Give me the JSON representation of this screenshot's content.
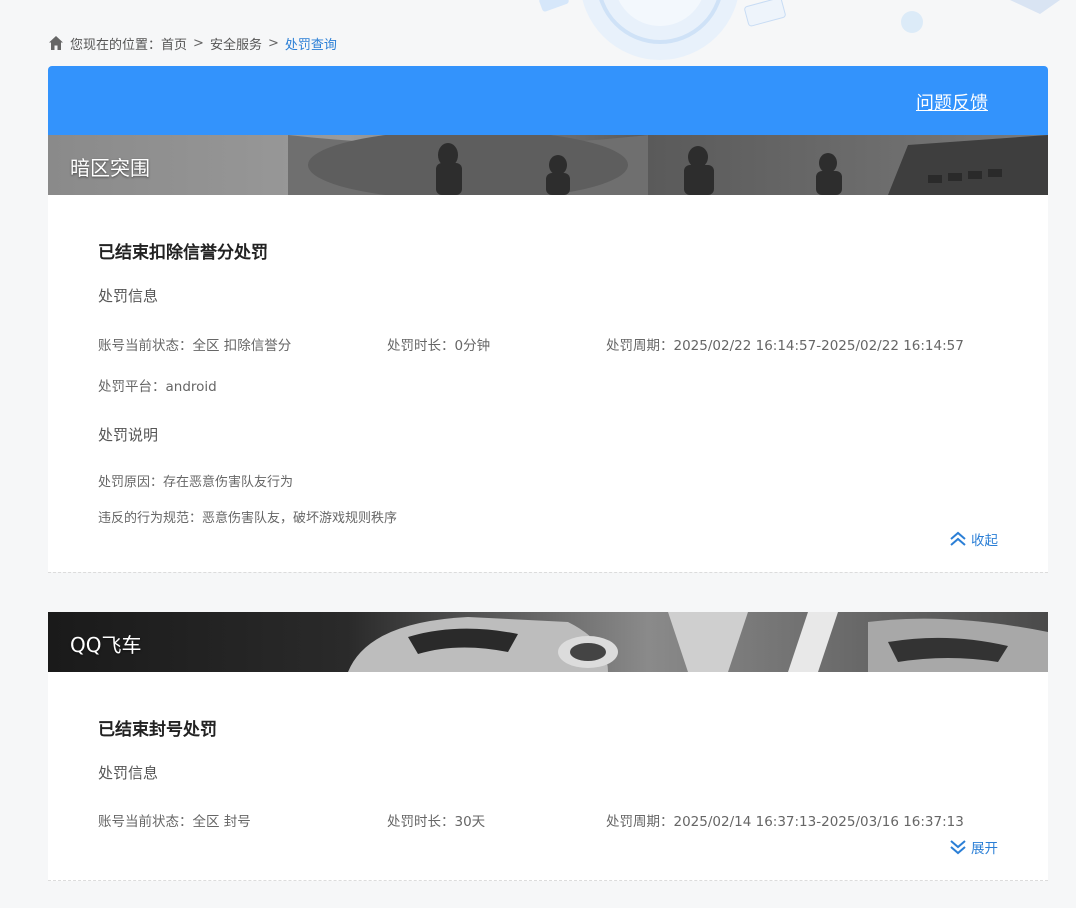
{
  "breadcrumb": {
    "prefix": "您现在的位置：",
    "items": [
      "首页",
      "安全服务"
    ],
    "current": "处罚查询",
    "separator": ">"
  },
  "header": {
    "feedback_label": "问题反馈",
    "background_color": "#3393fc"
  },
  "records": [
    {
      "game": "暗区突围",
      "title": "已结束扣除信誉分处罚",
      "info_heading": "处罚信息",
      "status": "账号当前状态：全区 扣除信誉分",
      "duration": "处罚时长：0分钟",
      "period": "处罚周期：2025/02/22 16:14:57-2025/02/22 16:14:57",
      "platform": "处罚平台：android",
      "desc_heading": "处罚说明",
      "reason": "处罚原因：存在恶意伤害队友行为",
      "rule": "违反的行为规范：恶意伤害队友，破坏游戏规则秩序",
      "toggle_label": "收起",
      "toggle_icon": "chevron-double-up-icon"
    },
    {
      "game": "QQ飞车",
      "title": "已结束封号处罚",
      "info_heading": "处罚信息",
      "status": "账号当前状态：全区 封号",
      "duration": "处罚时长：30天",
      "period": "处罚周期：2025/02/14 16:37:13-2025/03/16 16:37:13",
      "toggle_label": "展开",
      "toggle_icon": "chevron-double-down-icon"
    }
  ]
}
